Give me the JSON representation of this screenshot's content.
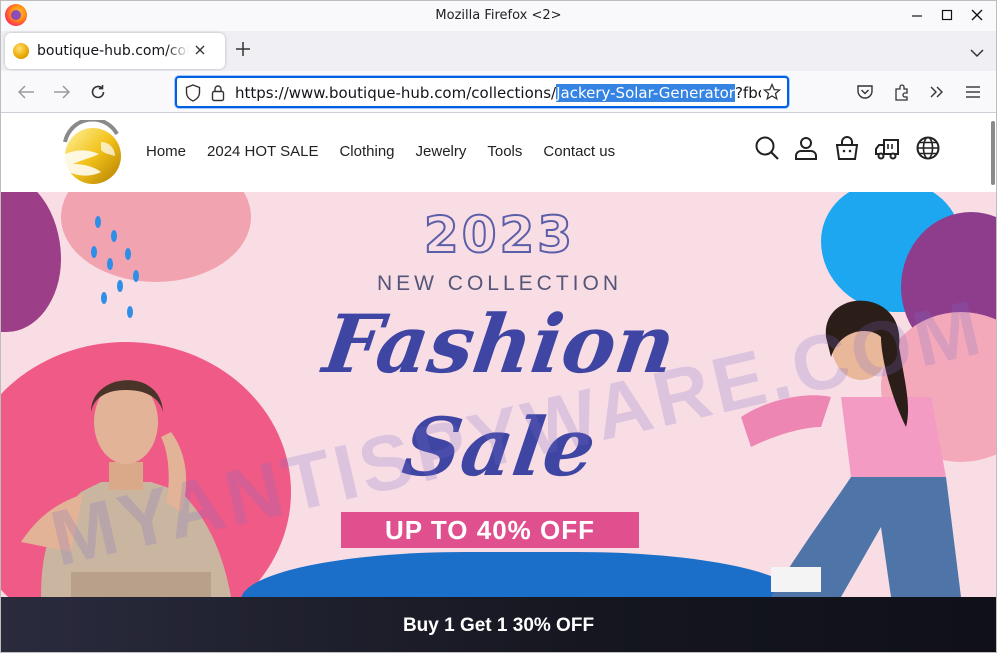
{
  "window": {
    "title": "Mozilla Firefox <2>"
  },
  "tab": {
    "title": "boutique-hub.com/collec"
  },
  "url": {
    "before": "https://www.boutique-hub.com/collections/",
    "selected": "Jackery-Solar-Generator",
    "after": "?fbclid"
  },
  "site": {
    "menu": [
      "Home",
      "2024 HOT SALE",
      "Clothing",
      "Jewelry",
      "Tools",
      "Contact us"
    ],
    "header_icons": [
      "search-icon",
      "account-icon",
      "cart-icon",
      "shipping-truck-icon",
      "language-globe-icon"
    ]
  },
  "hero": {
    "year": "2023",
    "subtitle": "NEW COLLECTION",
    "headline_1": "Fashion",
    "headline_2": "Sale",
    "offer": "UP TO 40% OFF"
  },
  "watermark": "MYANTISPYWARE.COM",
  "promo": {
    "text": "Buy 1 Get 1 30% OFF"
  },
  "colors": {
    "accent_blue": "#0061e0",
    "hero_bg": "#f9dde4",
    "headline": "#3e45a3",
    "offer_bg": "#e0508f",
    "promo_bg": "#15161f"
  }
}
